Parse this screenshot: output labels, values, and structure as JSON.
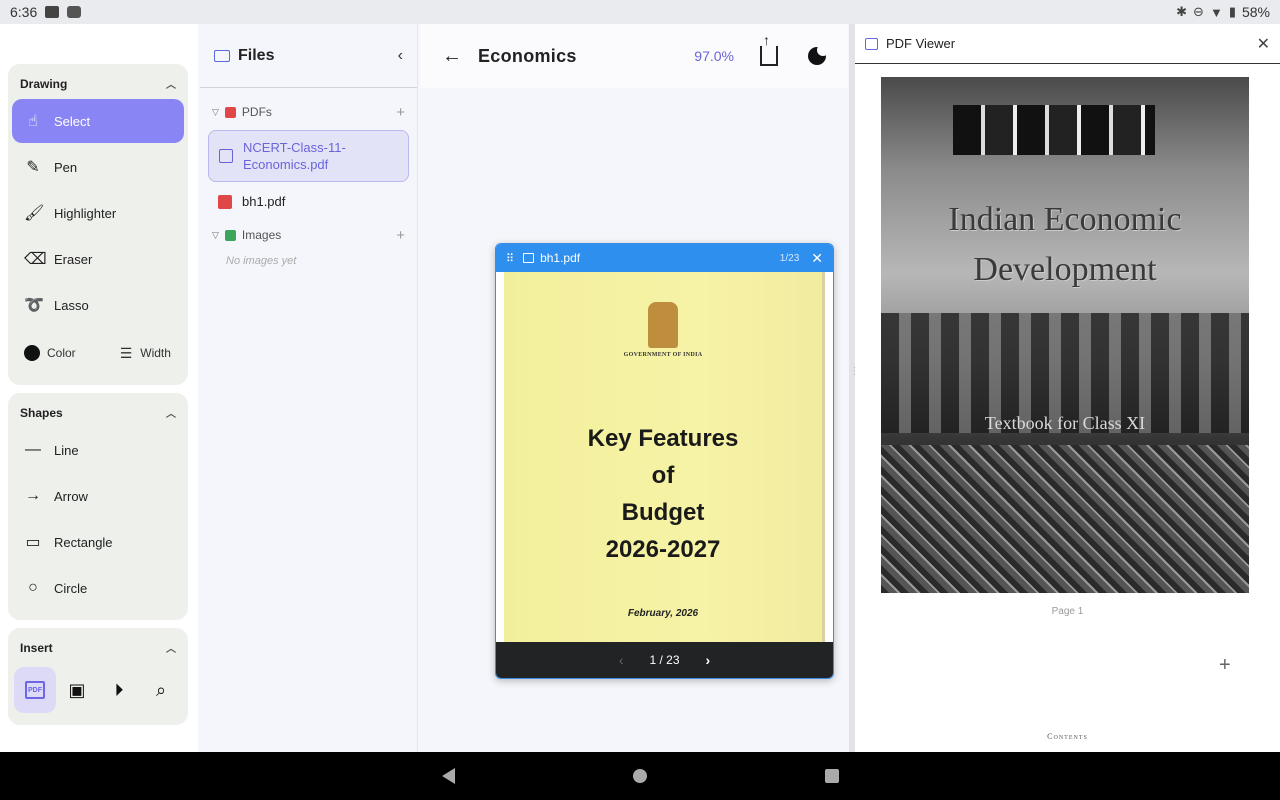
{
  "status": {
    "time": "6:36",
    "battery": "58%"
  },
  "tools": {
    "drawing": {
      "title": "Drawing",
      "items": [
        {
          "label": "Select",
          "icon": "hand-icon",
          "glyph": "☝"
        },
        {
          "label": "Pen",
          "icon": "pen-icon",
          "glyph": "✎"
        },
        {
          "label": "Highlighter",
          "icon": "highlighter-icon",
          "glyph": "🖌"
        },
        {
          "label": "Eraser",
          "icon": "eraser-icon",
          "glyph": "⌫"
        },
        {
          "label": "Lasso",
          "icon": "lasso-icon",
          "glyph": "➰"
        }
      ],
      "color_label": "Color",
      "width_label": "Width",
      "color_value": "#111111"
    },
    "shapes": {
      "title": "Shapes",
      "items": [
        {
          "label": "Line",
          "icon": "line-icon",
          "glyph": "—"
        },
        {
          "label": "Arrow",
          "icon": "arrow-icon",
          "glyph": "→"
        },
        {
          "label": "Rectangle",
          "icon": "rectangle-icon",
          "glyph": "▭"
        },
        {
          "label": "Circle",
          "icon": "circle-icon",
          "glyph": "○"
        }
      ]
    },
    "insert": {
      "title": "Insert"
    }
  },
  "files": {
    "title": "Files",
    "pdfs_label": "PDFs",
    "pdf_items": [
      "NCERT-Class-11-Economics.pdf",
      "bh1.pdf"
    ],
    "images_label": "Images",
    "images_empty": "No images yet"
  },
  "main": {
    "title": "Economics",
    "zoom": "97.0%"
  },
  "float": {
    "file": "bh1.pdf",
    "page_count": "1/23",
    "gov": "GOVERNMENT OF INDIA",
    "title_lines": [
      "Key Features",
      "of",
      "Budget",
      "2026-2027"
    ],
    "date": "February, 2026",
    "pager": "1 / 23"
  },
  "viewer": {
    "title": "PDF Viewer",
    "cover_title_1": "Indian Economic",
    "cover_title_2": "Development",
    "cover_sub": "Textbook for Class XI",
    "page_label": "Page 1",
    "next_page_heading": "Contents"
  },
  "colors": {
    "accent": "#8a85f4",
    "float_header": "#2f8fef",
    "pdf_red": "#e04848"
  }
}
